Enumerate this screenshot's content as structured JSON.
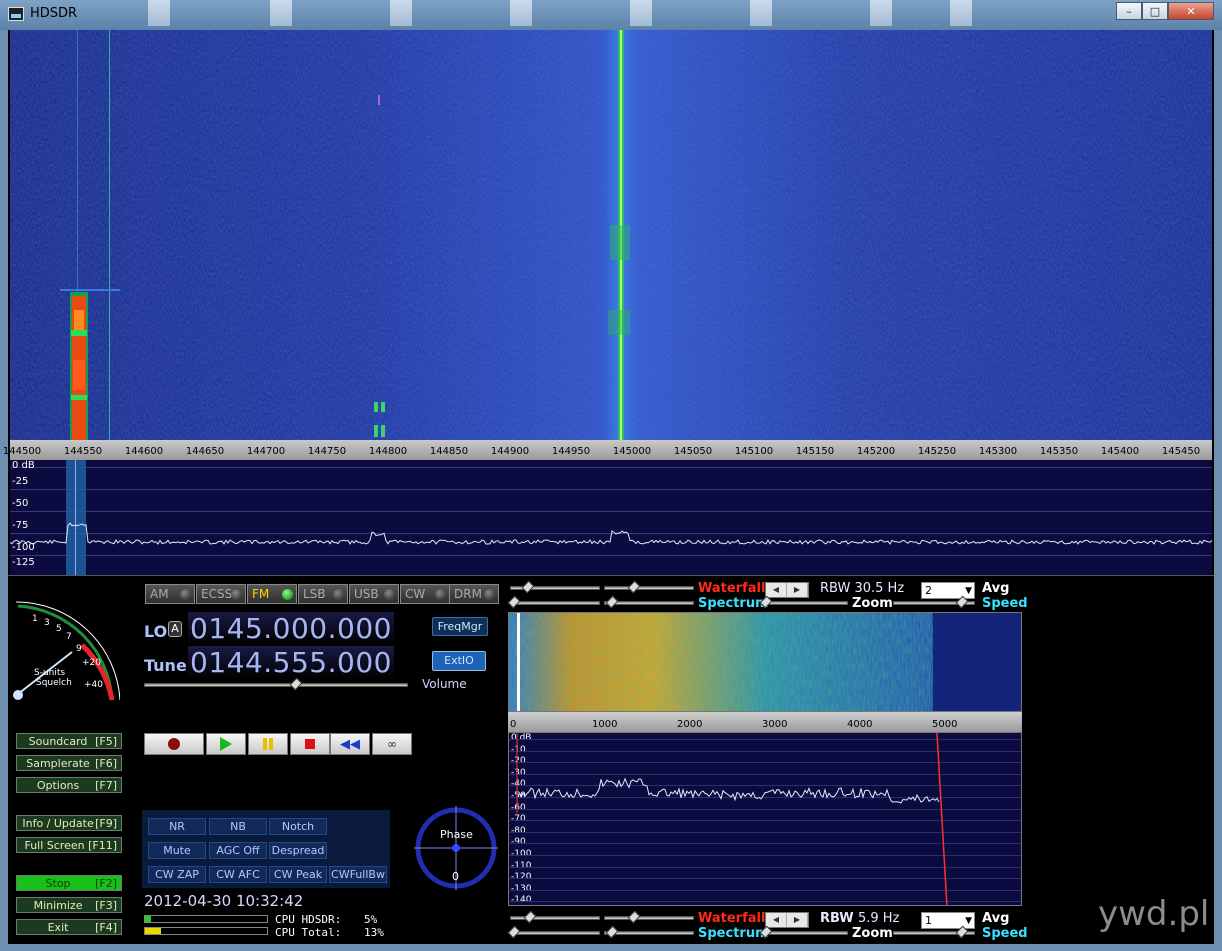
{
  "window": {
    "title": "HDSDR",
    "min_label": "–",
    "max_label": "□",
    "close_label": "✕"
  },
  "freq_scale": {
    "labels": [
      "144500",
      "144550",
      "144600",
      "144650",
      "144700",
      "144750",
      "144800",
      "144850",
      "144900",
      "144950",
      "145000",
      "145050",
      "145100",
      "145150",
      "145200",
      "145250",
      "145300",
      "145350",
      "145400",
      "145450"
    ]
  },
  "spectrum": {
    "db_labels": [
      "0 dB",
      "-25",
      "-50",
      "-75",
      "-100",
      "-125"
    ]
  },
  "modes": [
    {
      "label": "AM",
      "active": false
    },
    {
      "label": "ECSS",
      "active": false
    },
    {
      "label": "FM",
      "active": true
    },
    {
      "label": "LSB",
      "active": false
    },
    {
      "label": "USB",
      "active": false
    },
    {
      "label": "CW",
      "active": false
    },
    {
      "label": "DRM",
      "active": false
    }
  ],
  "smeter": {
    "label1": "S-units",
    "label2": "Squelch",
    "scale": [
      "1",
      "3",
      "5",
      "7",
      "9",
      "+20",
      "+40"
    ]
  },
  "lo": {
    "label": "LO",
    "marker": "A",
    "value": "0145.000.000"
  },
  "tune": {
    "label": "Tune",
    "value": "0144.555.000"
  },
  "freqmgr_label": "FreqMgr",
  "extio_label": "ExtIO",
  "volume_label": "Volume",
  "fkeys": [
    {
      "label": "Soundcard",
      "key": "[F5]"
    },
    {
      "label": "Samplerate",
      "key": "[F6]"
    },
    {
      "label": "Options",
      "key": "[F7]"
    },
    {
      "label": "Info / Update",
      "key": "[F9]"
    },
    {
      "label": "Full Screen",
      "key": "[F11]"
    },
    {
      "label": "Stop",
      "key": "[F2]"
    },
    {
      "label": "Minimize",
      "key": "[F3]"
    },
    {
      "label": "Exit",
      "key": "[F4]"
    }
  ],
  "dsp": [
    "NR",
    "NB",
    "Notch",
    "Mute",
    "AGC Off",
    "Despread",
    "CW ZAP",
    "CW AFC",
    "CW Peak",
    "CWFullBw"
  ],
  "phase": {
    "label": "Phase",
    "value": "0"
  },
  "datetime": "2012-04-30 10:32:42",
  "cpu": {
    "hdsdr_label": "CPU HDSDR:",
    "hdsdr_value": "5%",
    "total_label": "CPU Total:",
    "total_value": "13%",
    "hdsdr_fraction": 0.05,
    "total_fraction": 0.13
  },
  "af_top": {
    "waterfall_label": "Waterfall",
    "rbw": "RBW 30.5 Hz",
    "avg_value": "2",
    "avg_label": "Avg",
    "spectrum_label": "Spectrum",
    "zoom_label": "Zoom",
    "speed_label": "Speed"
  },
  "af_scale": [
    "0",
    "1000",
    "2000",
    "3000",
    "4000",
    "5000"
  ],
  "af_db": [
    "0 dB",
    "-10",
    "-20",
    "-30",
    "-40",
    "-50",
    "-60",
    "-70",
    "-80",
    "-90",
    "-100",
    "-110",
    "-120",
    "-130",
    "-140"
  ],
  "af_bottom": {
    "waterfall_label": "Waterfall",
    "rbw_label": "RBW",
    "rbw_value": "5.9 Hz",
    "avg_value": "1",
    "avg_label": "Avg",
    "spectrum_label": "Spectrum",
    "zoom_label": "Zoom",
    "speed_label": "Speed"
  },
  "watermark": "ywd.pl",
  "colors": {
    "accent_red": "#ff2a1a",
    "accent_cyan": "#39e0ff",
    "wf_bg": "#1a2f9a",
    "spec_bg": "#0b0b3f"
  }
}
